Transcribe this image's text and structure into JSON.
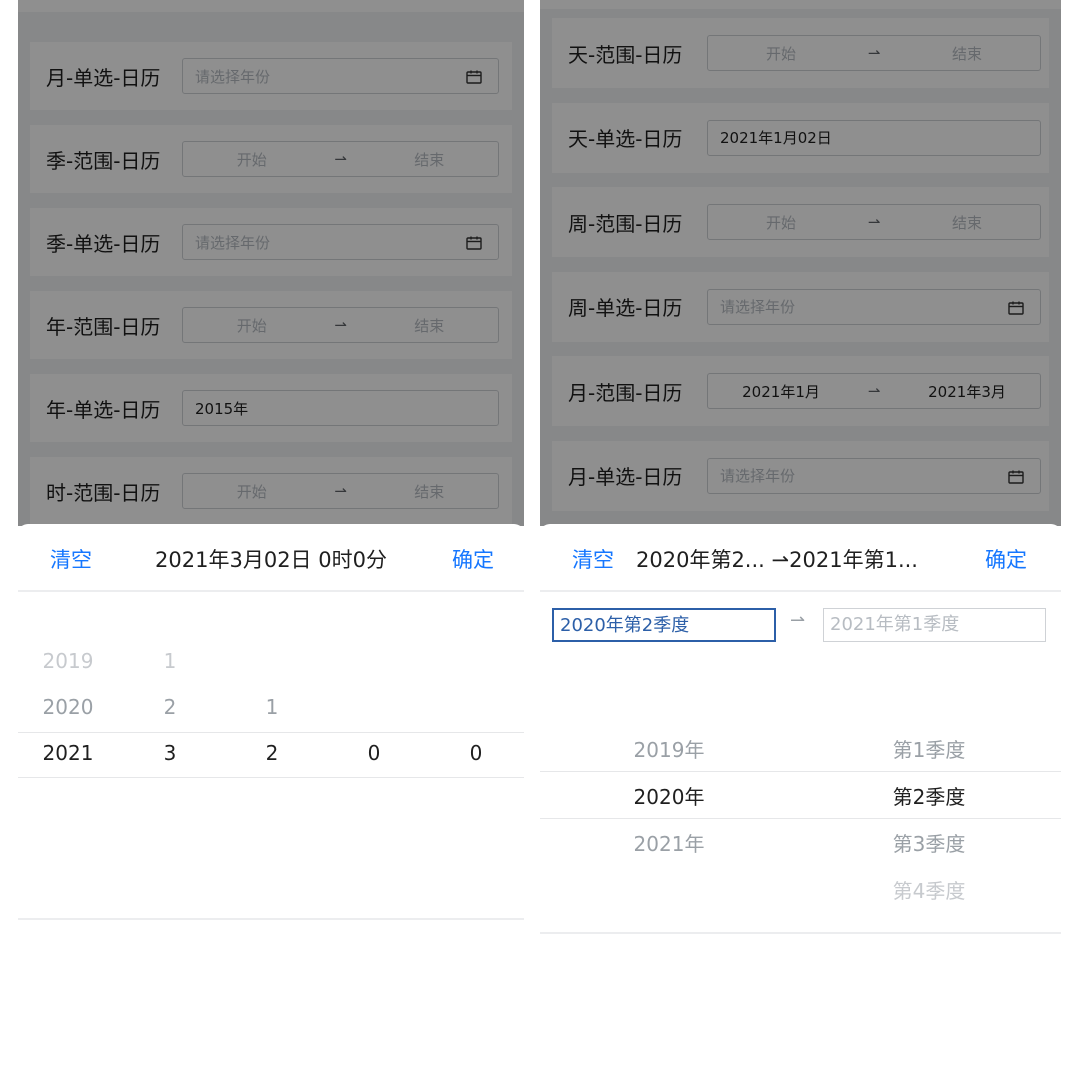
{
  "left": {
    "rows": [
      {
        "label": "月-单选-日历",
        "kind": "single",
        "placeholder": "请选择年份",
        "value": "",
        "icon": "calendar-icon"
      },
      {
        "label": "季-范围-日历",
        "kind": "range",
        "start": "开始",
        "end": "结束"
      },
      {
        "label": "季-单选-日历",
        "kind": "single",
        "placeholder": "请选择年份",
        "value": "",
        "icon": "calendar-icon"
      },
      {
        "label": "年-范围-日历",
        "kind": "range",
        "start": "开始",
        "end": "结束"
      },
      {
        "label": "年-单选-日历",
        "kind": "single",
        "placeholder": "",
        "value": "2015年"
      },
      {
        "label": "时-范围-日历",
        "kind": "range",
        "start": "开始",
        "end": "结束"
      }
    ],
    "sheet": {
      "clear_label": "清空",
      "title": "2021年3月02日 0时0分",
      "confirm_label": "确定",
      "columns": [
        {
          "items": [
            "2019",
            "2020",
            "2021"
          ],
          "selected": 2
        },
        {
          "items": [
            "1",
            "2",
            "3"
          ],
          "selected": 2
        },
        {
          "items": [
            "1",
            "2"
          ],
          "selected": 1
        },
        {
          "items": [
            "0"
          ],
          "selected": 0
        },
        {
          "items": [
            "0"
          ],
          "selected": 0
        }
      ]
    }
  },
  "right": {
    "rows": [
      {
        "label": "天-范围-日历",
        "kind": "range",
        "start": "开始",
        "end": "结束"
      },
      {
        "label": "天-单选-日历",
        "kind": "single",
        "placeholder": "",
        "value": "2021年1月02日"
      },
      {
        "label": "周-范围-日历",
        "kind": "range",
        "start": "开始",
        "end": "结束"
      },
      {
        "label": "周-单选-日历",
        "kind": "single",
        "placeholder": "请选择年份",
        "value": "",
        "icon": "calendar-icon"
      },
      {
        "label": "月-范围-日历",
        "kind": "range",
        "start": "2021年1月",
        "end": "2021年3月",
        "filled": true
      },
      {
        "label": "月-单选-日历",
        "kind": "single",
        "placeholder": "请选择年份",
        "value": "",
        "icon": "calendar-icon"
      }
    ],
    "sheet": {
      "clear_label": "清空",
      "title_start": "2020年第2...",
      "title_end": "2021年第1...",
      "confirm_label": "确定",
      "range_start": "2020年第2季度",
      "range_end": "2021年第1季度",
      "columns": [
        {
          "items": [
            "2019年",
            "2020年",
            "2021年"
          ],
          "selected": 1
        },
        {
          "items": [
            "第1季度",
            "第2季度",
            "第3季度",
            "第4季度"
          ],
          "selected": 1
        }
      ]
    }
  },
  "arrow_glyph": "⇀",
  "colors": {
    "accent": "#1677ff",
    "active_tab": "#2c5fa8",
    "overlay": "rgba(0,0,0,0.44)"
  }
}
